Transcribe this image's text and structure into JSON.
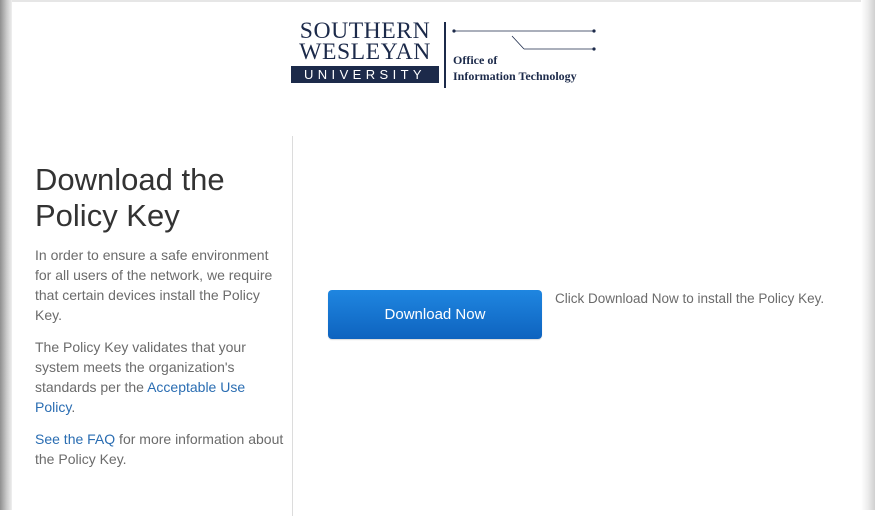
{
  "logo": {
    "line1": "SOUTHERN",
    "line2": "WESLEYAN",
    "line3": "UNIVERSITY",
    "office_line1": "Office of",
    "office_line2": "Information Technology"
  },
  "main": {
    "title": "Download the Policy Key",
    "para1": "In order to ensure a safe environment for all users of the network, we require that certain devices install the Policy Key.",
    "para2_text": "The Policy Key validates that your system meets the organization's standards per the ",
    "para2_link": "Acceptable Use Policy",
    "para2_end": ".",
    "para3_link": "See the FAQ",
    "para3_text": " for more information about the Policy Key.",
    "download_button": "Download Now",
    "help_text": "Click Download Now to install the Policy Key."
  },
  "colors": {
    "brand_navy": "#1c2a4a",
    "button_blue": "#0e63bf",
    "link_blue": "#2a6db2"
  }
}
